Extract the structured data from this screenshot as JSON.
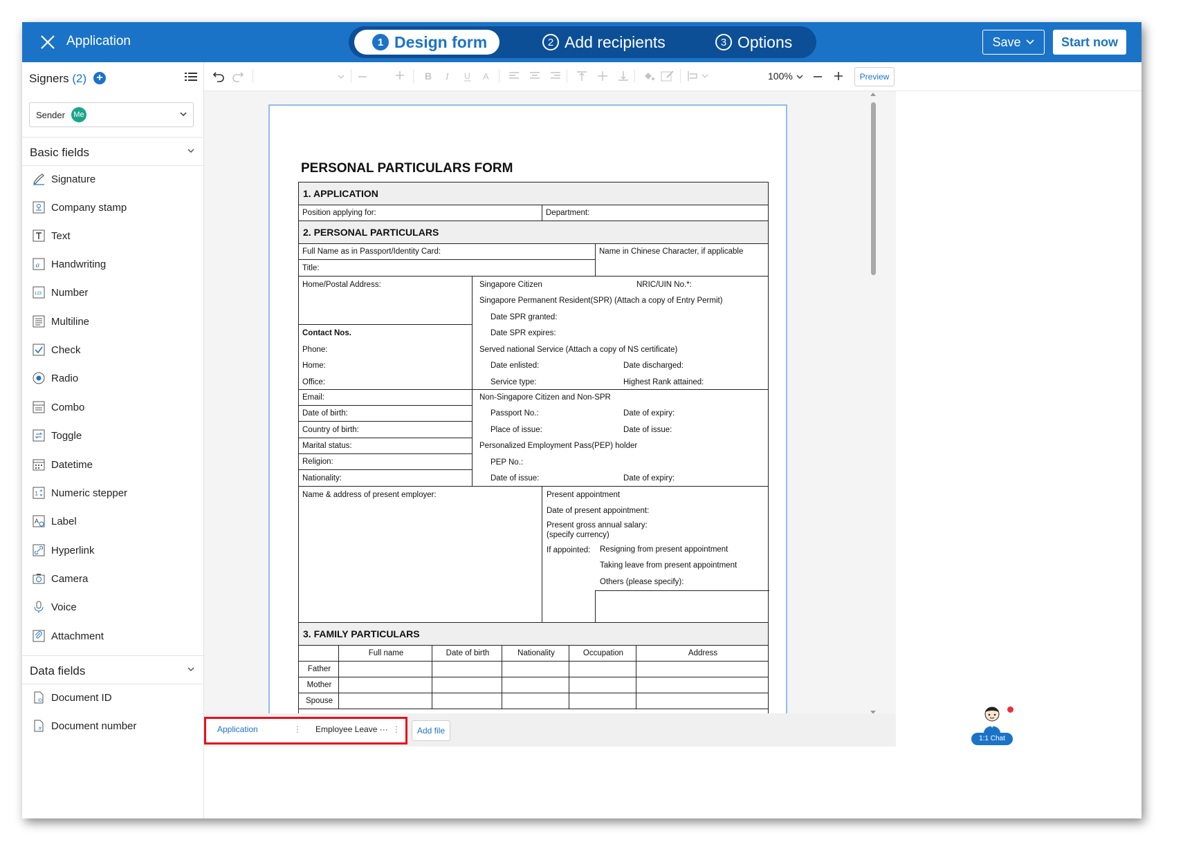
{
  "app": {
    "title": "Application"
  },
  "steps": [
    {
      "num": "1",
      "label": "Design form"
    },
    {
      "num": "2",
      "label": "Add recipients"
    },
    {
      "num": "3",
      "label": "Options"
    }
  ],
  "actions": {
    "save": "Save",
    "start": "Start now"
  },
  "sidebar": {
    "signers_label": "Signers",
    "signers_count": "(2)",
    "sender_label": "Sender",
    "sender_badge": "Me",
    "basic_fields_title": "Basic fields",
    "basic_fields": [
      "Signature",
      "Company stamp",
      "Text",
      "Handwriting",
      "Number",
      "Multiline",
      "Check",
      "Radio",
      "Combo",
      "Toggle",
      "Datetime",
      "Numeric stepper",
      "Label",
      "Hyperlink",
      "Camera",
      "Voice",
      "Attachment"
    ],
    "data_fields_title": "Data fields",
    "data_fields": [
      "Document ID",
      "Document number"
    ]
  },
  "toolbar": {
    "zoom": "100%",
    "preview": "Preview"
  },
  "form": {
    "title": "PERSONAL PARTICULARS FORM",
    "s1": "1. APPLICATION",
    "position": "Position applying for:",
    "department": "Department:",
    "s2": "2. PERSONAL PARTICULARS",
    "fullname": "Full Name as in Passport/Identity Card:",
    "chinese": "Name in Chinese Character, if applicable",
    "title_field": "Title:",
    "address": "Home/Postal Address:",
    "sg_citizen": "Singapore Citizen",
    "nric": "NRIC/UIN No.*:",
    "spr": "Singapore Permanent Resident(SPR) (Attach a copy of Entry Permit)",
    "spr_granted": "Date SPR granted:",
    "spr_expires": "Date SPR expires:",
    "ns": "Served national Service (Attach a copy of NS certificate)",
    "enlisted": "Date enlisted:",
    "discharged": "Date discharged:",
    "service_type": "Service type:",
    "rank": "Highest Rank attained:",
    "contact": "Contact Nos.",
    "phone": "Phone:",
    "home": "Home:",
    "office": "Office:",
    "email": "Email:",
    "dob": "Date of birth:",
    "cob": "Country of birth:",
    "marital": "Marital status:",
    "religion": "Religion:",
    "nationality": "Nationality:",
    "non_sg": "Non-Singapore Citizen and Non-SPR",
    "passport": "Passport No.:",
    "expiry": "Date of expiry:",
    "place_issue": "Place of issue:",
    "date_issue": "Date of issue:",
    "pep": "Personalized Employment Pass(PEP) holder",
    "pep_no": "PEP No.:",
    "pep_issue": "Date of issue:",
    "pep_expiry": "Date of expiry:",
    "employer": "Name & address of present employer:",
    "present_appt": "Present appointment",
    "date_present_appt": "Date of present appointment:",
    "salary": "Present gross annual salary:",
    "currency": "(specify currency)",
    "if_appointed": "If appointed:",
    "resigning": "Resigning from present appointment",
    "taking_leave": "Taking leave from present appointment",
    "others": "Others (please specify):",
    "s3": "3. FAMILY PARTICULARS",
    "family_headers": [
      "Full name",
      "Date of birth",
      "Nationality",
      "Occupation",
      "Address"
    ],
    "family_rows": [
      "Father",
      "Mother",
      "Spouse"
    ]
  },
  "files": {
    "tab1": "Application",
    "tab2": "Employee Leave ···",
    "add": "Add file"
  },
  "chat": {
    "label": "1:1 Chat"
  },
  "colors": {
    "primary": "#1b73c8",
    "step_track": "#0c4f96",
    "highlight": "#e8101b",
    "me_badge": "#1aa58a"
  }
}
